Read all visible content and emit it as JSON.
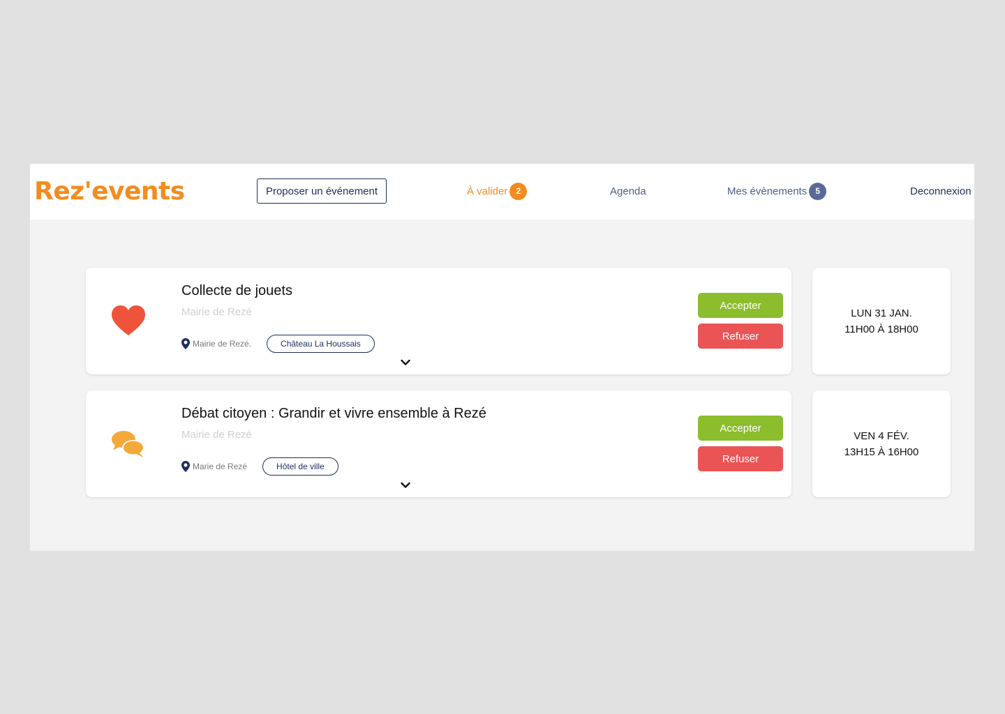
{
  "brand": {
    "logo": "Rez'events",
    "logo_color": "#f28c1e"
  },
  "nav": {
    "propose_label": "Proposer un événement",
    "valider_label": "À valider",
    "valider_count": "2",
    "agenda_label": "Agenda",
    "mes_label": "Mes évènements",
    "mes_count": "5",
    "logout_label": "Deconnexion"
  },
  "events": [
    {
      "icon": "heart-icon",
      "title": "Collecte de jouets",
      "organizer": "Mairie de Rezé",
      "location_org": "Mairie de Rezé.",
      "place": "Château La Houssais",
      "accept_label": "Accepter",
      "refuse_label": "Refuser",
      "date_line1": "LUN 31 JAN.",
      "date_line2": "11H00 À 18H00"
    },
    {
      "icon": "chat-bubbles-icon",
      "title": "Débat citoyen : Grandir et vivre ensemble à Rezé",
      "organizer": "Mairie de Rezé",
      "location_org": "Marie de Rezé",
      "place": "Hôtel de ville",
      "accept_label": "Accepter",
      "refuse_label": "Refuser",
      "date_line1": "VEN 4 FÉV.",
      "date_line2": "13H15 À 16H00"
    }
  ],
  "colors": {
    "accent_orange": "#f28c1e",
    "navy": "#1d2d5c",
    "accept_green": "#8bbd2c",
    "refuse_red": "#ea5454",
    "heart_red": "#f0533b",
    "chat_orange": "#f5a93a"
  }
}
